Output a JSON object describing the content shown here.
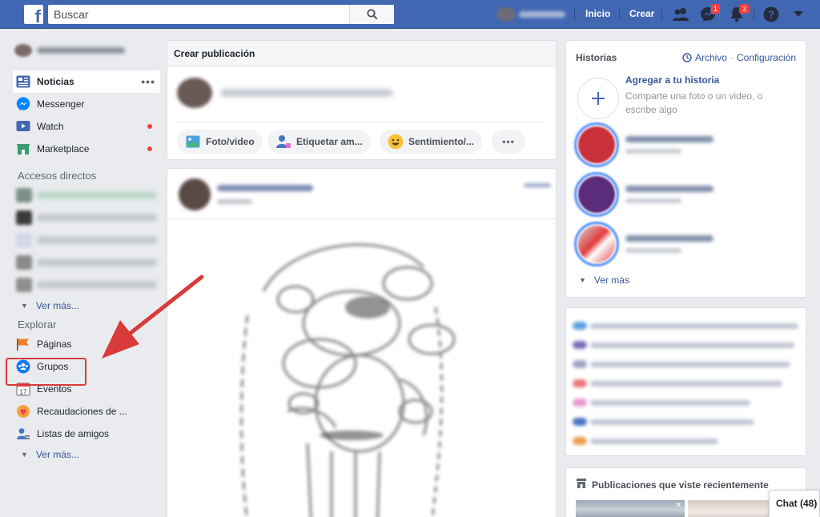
{
  "topbar": {
    "logo": "f",
    "search_placeholder": "Buscar",
    "links": {
      "home": "Inicio",
      "create": "Crear"
    },
    "badges": {
      "messages": "1",
      "notifications": "2"
    }
  },
  "sidebar": {
    "main_items": [
      {
        "label": "Noticias",
        "icon": "news-feed-icon"
      },
      {
        "label": "Messenger",
        "icon": "messenger-icon"
      },
      {
        "label": "Watch",
        "icon": "watch-icon"
      },
      {
        "label": "Marketplace",
        "icon": "marketplace-icon"
      }
    ],
    "shortcuts_title": "Accesos directos",
    "shortcuts_more": "Ver más...",
    "explore_title": "Explorar",
    "explore_items": [
      {
        "label": "Páginas",
        "icon": "flag-icon"
      },
      {
        "label": "Grupos",
        "icon": "groups-icon"
      },
      {
        "label": "Eventos",
        "icon": "calendar-icon",
        "day": "17"
      },
      {
        "label": "Recaudaciones de ...",
        "icon": "fundraiser-icon"
      },
      {
        "label": "Listas de amigos",
        "icon": "friends-list-icon"
      }
    ],
    "explore_more": "Ver más..."
  },
  "composer": {
    "title": "Crear publicación",
    "actions": [
      {
        "label": "Foto/video",
        "icon": "photo-icon"
      },
      {
        "label": "Etiquetar am...",
        "icon": "tag-friends-icon"
      },
      {
        "label": "Sentimiento/...",
        "icon": "feeling-icon"
      }
    ]
  },
  "stories": {
    "title": "Historias",
    "archive": "Archivo",
    "settings": "Configuración",
    "add_title": "Agregar a tu historia",
    "add_subtitle": "Comparte una foto o un video, o escribe algo",
    "more": "Ver más"
  },
  "recent": {
    "title": "Publicaciones que viste recientemente"
  },
  "chat": {
    "label": "Chat (48)"
  },
  "colors": {
    "brand": "#4267b2",
    "link": "#365899",
    "alert": "#fa3e3e",
    "annotation": "#d93a3a"
  }
}
